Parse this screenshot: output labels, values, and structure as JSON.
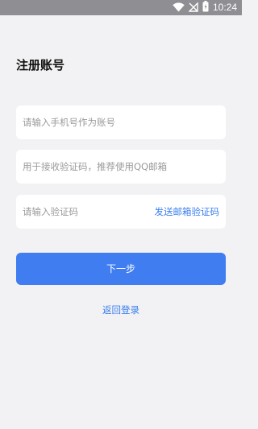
{
  "status_bar": {
    "time": "10:24",
    "battery_level": "0.8",
    "icons": [
      "wifi-icon",
      "signal-off-icon",
      "battery-icon"
    ]
  },
  "page": {
    "title": "注册账号"
  },
  "form": {
    "phone_placeholder": "请输入手机号作为账号",
    "email_placeholder": "用于接收验证码，推荐使用QQ邮箱",
    "code_placeholder": "请输入验证码",
    "send_code_label": "发送邮箱验证码",
    "next_label": "下一步",
    "back_login_label": "返回登录"
  },
  "colors": {
    "background": "#f2f2f4",
    "status_bar": "#8f8f93",
    "primary": "#3f7df0",
    "link": "#3a7ff0"
  }
}
